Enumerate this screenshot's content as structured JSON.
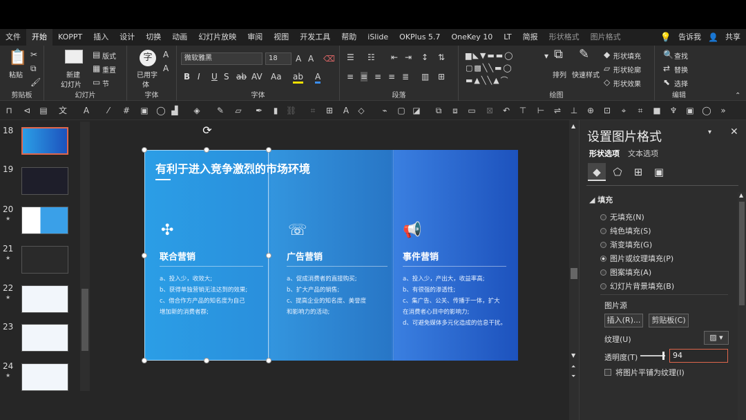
{
  "tabs": [
    "文件",
    "开始",
    "KOPPT",
    "插入",
    "设计",
    "切换",
    "动画",
    "幻灯片放映",
    "审阅",
    "视图",
    "开发工具",
    "帮助",
    "iSlide",
    "OKPlus 5.7",
    "OneKey 10",
    "LT",
    "简报",
    "形状格式",
    "图片格式"
  ],
  "tabs_active": "开始",
  "tell_me": "告诉我",
  "share": "共享",
  "ribbon": {
    "clipboard": {
      "paste": "粘贴",
      "label": "剪贴板"
    },
    "slides": {
      "new_slide": "新建",
      "new_slide2": "幻灯片",
      "layout": "版式",
      "reset": "重置",
      "section": "节",
      "label": "幻灯片"
    },
    "font_tool": {
      "use_font": "已用字",
      "use_font2": "体",
      "label": "字体"
    },
    "font": {
      "name": "微软雅黑",
      "size": "18",
      "label": "字体"
    },
    "paragraph": {
      "label": "段落"
    },
    "drawing": {
      "arrange": "排列",
      "quick_styles": "快速样式",
      "fill": "形状填充",
      "outline": "形状轮廓",
      "effects": "形状效果",
      "label": "绘图"
    },
    "editing": {
      "find": "查找",
      "replace": "替换",
      "select": "选择",
      "label": "编辑"
    }
  },
  "thumbs": [
    {
      "num": "18",
      "star": false
    },
    {
      "num": "19",
      "star": false
    },
    {
      "num": "20",
      "star": true
    },
    {
      "num": "21",
      "star": true
    },
    {
      "num": "22",
      "star": true
    },
    {
      "num": "23",
      "star": false
    },
    {
      "num": "24",
      "star": true
    }
  ],
  "slide": {
    "title": "有利于进入竞争激烈的市场环境",
    "columns": [
      {
        "title": "联合营销",
        "icon": "network-icon",
        "lines": [
          "a、投入少，收效大;",
          "b、获得单独营销无法达到的效果;",
          "c、借合作方产品的知名度为自己",
          "增加新的消费者群;"
        ]
      },
      {
        "title": "广告营销",
        "icon": "billboard-icon",
        "lines": [
          "a、促成消费者的直接购买;",
          "b、扩大产品的销售;",
          "c、提高企业的知名度、美誉度",
          "和影响力的活动;"
        ]
      },
      {
        "title": "事件营销",
        "icon": "megaphone-icon",
        "lines": [
          "a、投入少，产出大，收益率高;",
          "b、有很强的渗透性;",
          "c、集广告、公关、传播于一体，扩大",
          "在消费者心目中的影响力;",
          "d、可避免媒体多元化造成的信息干扰。"
        ]
      }
    ]
  },
  "pane": {
    "title": "设置图片格式",
    "tab_shape": "形状选项",
    "tab_text": "文本选项",
    "section_fill": "填充",
    "options": [
      "无填充(N)",
      "纯色填充(S)",
      "渐变填充(G)",
      "图片或纹理填充(P)",
      "图案填充(A)",
      "幻灯片背景填充(B)"
    ],
    "selected_option": 3,
    "picture_source": "图片源",
    "insert": "插入(R)...",
    "clipboard": "剪贴板(C)",
    "texture": "纹理(U)",
    "transparency_label": "透明度(T)",
    "transparency_value": "94",
    "tile": "将图片平铺为纹理(I)"
  }
}
